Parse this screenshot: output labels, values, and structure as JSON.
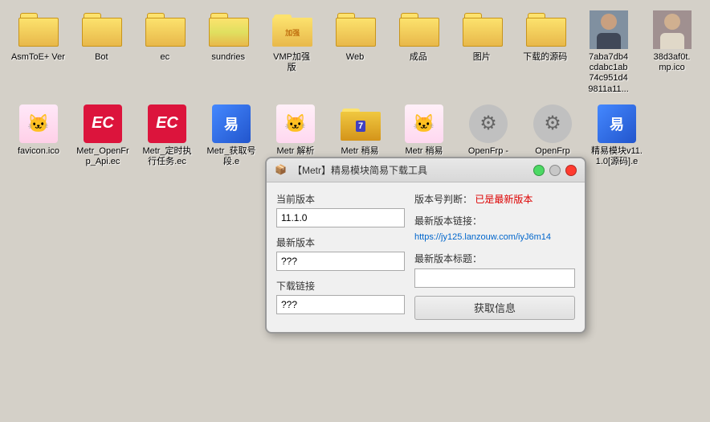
{
  "desktop": {
    "background": "#d4d0c8"
  },
  "icons_row1": [
    {
      "id": "AsmToEVer",
      "label": "AsmToE+\nVer",
      "type": "folder"
    },
    {
      "id": "Bot",
      "label": "Bot",
      "type": "folder"
    },
    {
      "id": "ec",
      "label": "ec",
      "type": "folder"
    },
    {
      "id": "sundries",
      "label": "sundries",
      "type": "folder"
    },
    {
      "id": "VMPJiaGu",
      "label": "VMP加强\n版",
      "type": "folder"
    },
    {
      "id": "Web",
      "label": "Web",
      "type": "folder"
    },
    {
      "id": "ChengPin",
      "label": "成品",
      "type": "folder"
    },
    {
      "id": "TuPian",
      "label": "图片",
      "type": "folder"
    },
    {
      "id": "XiaZaiYuanMa",
      "label": "下载的源码",
      "type": "folder"
    },
    {
      "id": "7aba7db4",
      "label": "7aba7db4cdabc1ab74c951d49811a11...",
      "type": "photo1"
    },
    {
      "id": "38d3af0t",
      "label": "38d3af0t.mp.ico",
      "type": "photo2"
    }
  ],
  "icons_row2": [
    {
      "id": "favicon",
      "label": "favicon.ico",
      "type": "anime"
    },
    {
      "id": "MetrOpenFrpApi",
      "label": "Metr_OpenFrp_Api.ec",
      "type": "ec_red"
    },
    {
      "id": "MetrDingShiZhiXing",
      "label": "Metr_定时执行任务.ec",
      "type": "ec_red"
    },
    {
      "id": "MetrHuoQuHaoMa",
      "label": "Metr_获取号段.e",
      "type": "blue_zip"
    },
    {
      "id": "MetrJieXi",
      "label": "Metr 解析",
      "type": "anime2"
    },
    {
      "id": "MetrJingYi1",
      "label": "Metr 稍易",
      "type": "folder_img"
    },
    {
      "id": "MetrJingYi2",
      "label": "Metr 稍易",
      "type": "anime3"
    },
    {
      "id": "OpenFrpMinus",
      "label": "OpenFrp -",
      "type": "gear"
    },
    {
      "id": "OpenFrp",
      "label": "OpenFrp",
      "type": "gear2"
    },
    {
      "id": "JingYiMokuai",
      "label": "精易模块v11.1.0[源码].e",
      "type": "blue_zip2"
    }
  ],
  "modal": {
    "title": "【Metr】精易模块简易下载工具",
    "current_version_label": "当前版本",
    "current_version_value": "11.1.0",
    "latest_version_label": "最新版本",
    "latest_version_value": "???",
    "download_link_label": "下载链接",
    "download_link_value": "???",
    "version_check_label": "版本号判断：",
    "version_check_value": "已是最新版本",
    "latest_link_label": "最新版本链接：",
    "latest_link_value": "https://jy125.lanzouw.com/iyJ6m14",
    "latest_title_label": "最新版本标题：",
    "latest_title_value": "",
    "get_info_button": "获取信息"
  }
}
